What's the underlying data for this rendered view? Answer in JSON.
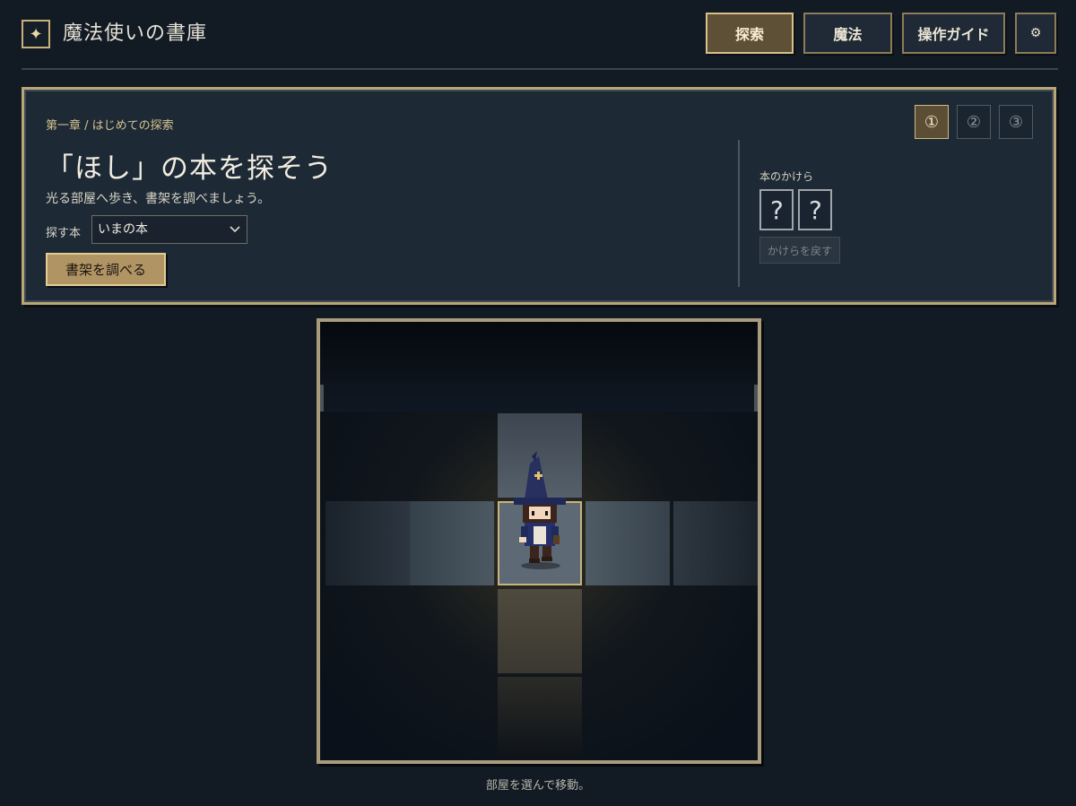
{
  "header": {
    "logo_glyph": "✦",
    "title": "魔法使いの書庫",
    "nav": [
      {
        "label": "探索",
        "active": true
      },
      {
        "label": "魔法",
        "active": false
      },
      {
        "label": "操作ガイド",
        "active": false
      }
    ],
    "settings_glyph": "⚙"
  },
  "quest": {
    "breadcrumb": "第一章 / はじめての探索",
    "title": "「ほし」の本を探そう",
    "description": "光る部屋へ歩き、書架を調べましょう。",
    "book_label": "探す本",
    "book_selected": "いまの本",
    "search_button": "書架を調べる",
    "steps": [
      "①",
      "②",
      "③"
    ],
    "current_step": 1,
    "fragments_label": "本のかけら",
    "fragments": [
      "?",
      "?"
    ],
    "return_fragments_button": "かけらを戻す"
  },
  "map": {
    "hint": "部屋を選んで移動。",
    "player_room": "center",
    "colors": {
      "lit_room": "#5d6a75",
      "highlight_border": "#c9b47c",
      "frame": "#a89c7c"
    }
  }
}
